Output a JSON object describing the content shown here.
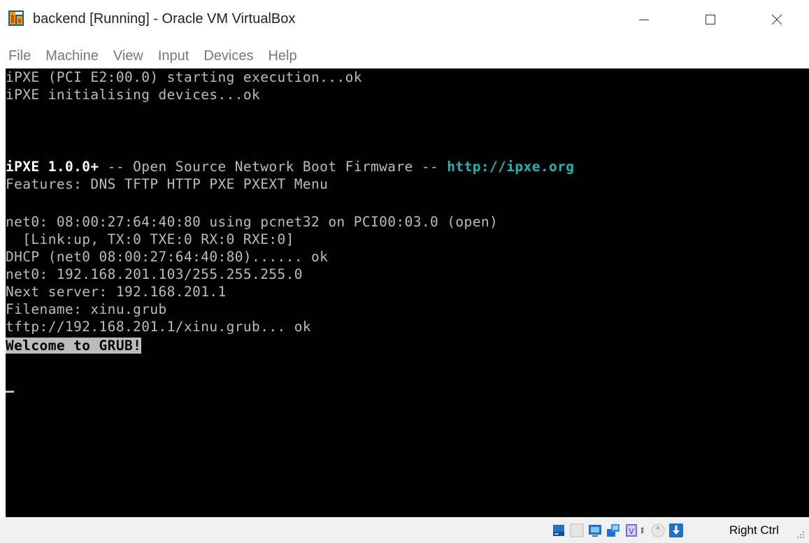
{
  "window": {
    "title": "backend [Running] - Oracle VM VirtualBox",
    "icon": "virtualbox-icon"
  },
  "menu": {
    "items": [
      "File",
      "Machine",
      "View",
      "Input",
      "Devices",
      "Help"
    ]
  },
  "console": {
    "lines": [
      "iPXE (PCI E2:00.0) starting execution...ok",
      "iPXE initialising devices...ok",
      "",
      "",
      "",
      "",
      "Features: DNS TFTP HTTP PXE PXEXT Menu",
      "",
      "net0: 08:00:27:64:40:80 using pcnet32 on PCI00:03.0 (open)",
      "  [Link:up, TX:0 TXE:0 RX:0 RXE:0]",
      "DHCP (net0 08:00:27:64:40:80)...... ok",
      "net0: 192.168.201.103/255.255.255.0",
      "Next server: 192.168.201.1",
      "Filename: xinu.grub",
      "tftp://192.168.201.1/xinu.grub... ok"
    ],
    "banner": {
      "product": "iPXE 1.0.0+",
      "middle": " -- Open Source Network Boot Firmware -- ",
      "url": "http://ipxe.org"
    },
    "grub_welcome": "Welcome to GRUB!"
  },
  "statusbar": {
    "icons": [
      "hard-disk-icon",
      "optical-drive-icon",
      "display-icon",
      "network-icon",
      "usb-icon",
      "recording-icon",
      "mouse-integration-icon",
      "keyboard-capture-icon"
    ],
    "host_key": "Right Ctrl"
  },
  "colors": {
    "console_bg": "#000000",
    "console_fg": "#bcbcbc",
    "console_bright": "#ffffff",
    "console_link": "#1fb5b5",
    "statusbar_bg": "#f0f0f0"
  }
}
